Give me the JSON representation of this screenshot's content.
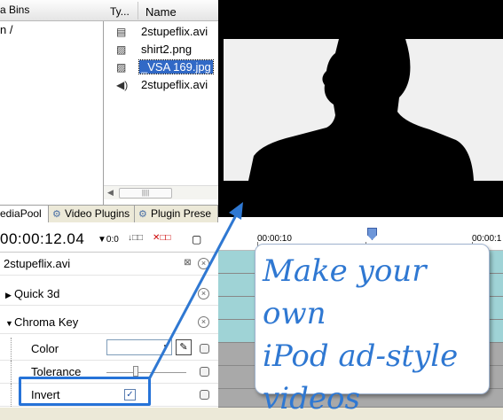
{
  "bins": {
    "header": "a Bins",
    "root": "n /"
  },
  "files": {
    "col_type": "Ty...",
    "col_name": "Name",
    "items": [
      {
        "icon": "film-icon",
        "glyph": "▤",
        "name": "2stupeflix.avi",
        "selected": false
      },
      {
        "icon": "image-icon",
        "glyph": "▨",
        "name": "shirt2.png",
        "selected": false
      },
      {
        "icon": "image-icon",
        "glyph": "▨",
        "name": "_VSA 169.jpg",
        "selected": true
      },
      {
        "icon": "audio-icon",
        "glyph": "◀)",
        "name": "2stupeflix.avi",
        "selected": false
      }
    ],
    "scroll_left": "◀",
    "scroll_grip": "||||"
  },
  "tabs": {
    "media": "ediaPool",
    "video": "Video Plugins",
    "preset": "Plugin Prese"
  },
  "toolbar": {
    "timecode": "00:00:12.04",
    "btn1": "▼0:0",
    "btn2": "↓□□",
    "btn3": "✕□□",
    "btn4": "▢"
  },
  "effects": {
    "clip": "2stupeflix.avi",
    "quick3d": "Quick 3d",
    "chroma": "Chroma Key",
    "color": "Color",
    "tolerance": "Tolerance",
    "invert": "Invert",
    "checkmark": "✓",
    "remove": "×",
    "picker": "✎",
    "dropdown": "▼",
    "expand": "▶",
    "collapse": "▼"
  },
  "ruler": {
    "time1": "00:00:10",
    "time2": "00:00:1"
  },
  "callout": {
    "text": "Make your own\niPod ad-style\nvideos"
  },
  "colors": {
    "accent": "#2f78d2",
    "highlight_border": "#2673d8",
    "selection": "#3169c6",
    "track": "#9fd3d6",
    "track_gray": "#a9a9a9"
  }
}
